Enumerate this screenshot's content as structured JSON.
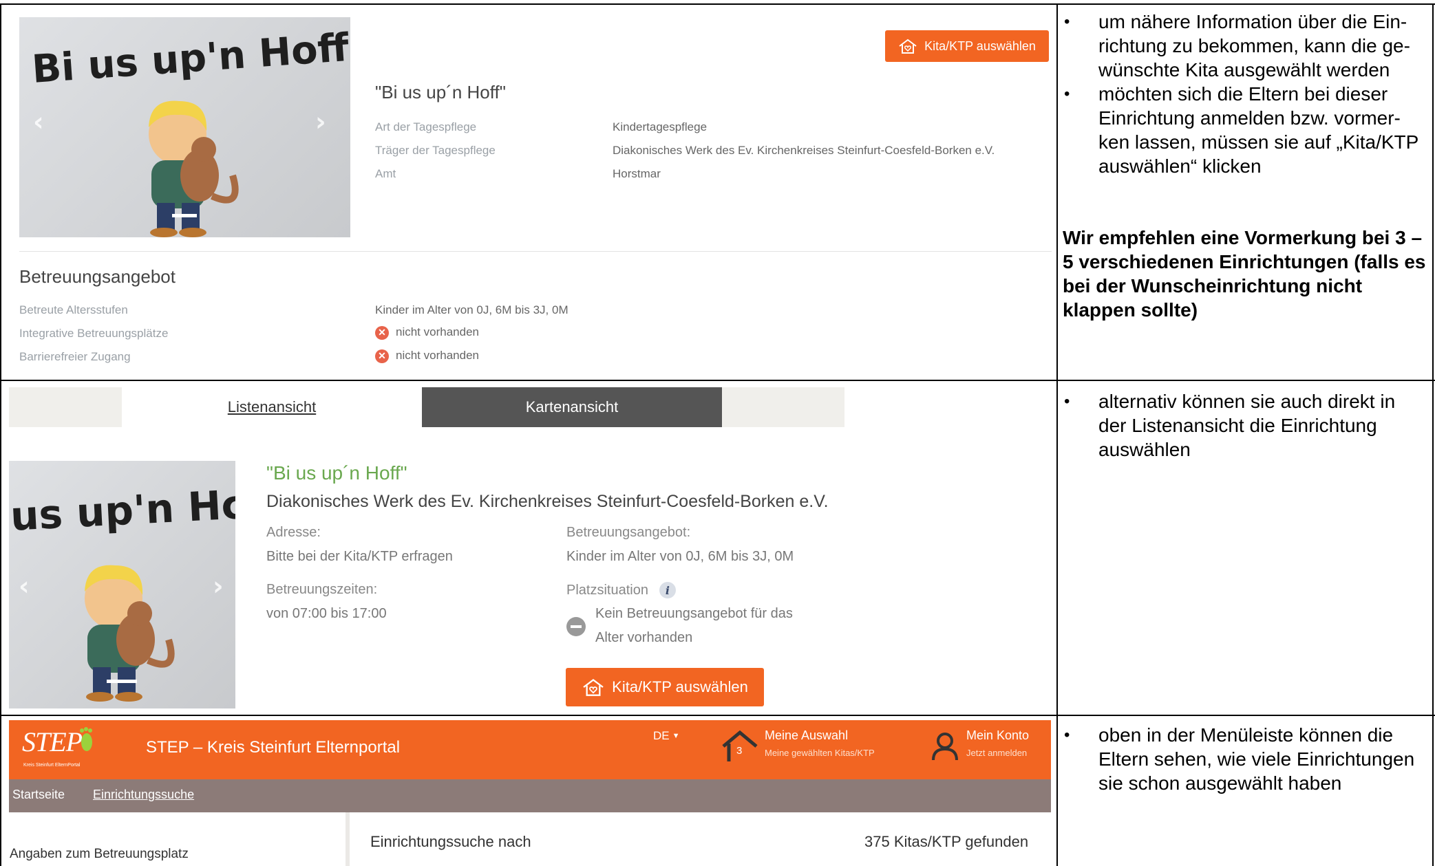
{
  "section1": {
    "photo_text": "Bi us up'n Hoff",
    "select_button": "Kita/KTP auswählen",
    "name": "\"Bi us up´n Hoff\"",
    "details": [
      {
        "label": "Art der Tagespflege",
        "value": "Kindertagespflege"
      },
      {
        "label": "Träger der Tagespflege",
        "value": "Diakonisches Werk des Ev. Kirchenkreises Steinfurt-Coesfeld-Borken e.V."
      },
      {
        "label": "Amt",
        "value": "Horstmar"
      }
    ],
    "offer_heading": "Betreuungsangebot",
    "offer": [
      {
        "label": "Betreute Altersstufen",
        "value": "Kinder im Alter von 0J, 6M bis 3J, 0M"
      },
      {
        "label": "Integrative Betreuungsplätze",
        "value": "nicht vorhanden"
      },
      {
        "label": "Barrierefreier Zugang",
        "value": "nicht vorhanden"
      }
    ],
    "notes": [
      "um nähere Information über die Ein-richtung zu bekommen, kann die ge-wünschte Kita ausgewählt werden",
      "möchten sich die Eltern bei dieser Einrichtung anmelden bzw. vormer-ken lassen, müssen sie auf „Kita/KTP auswählen“ klicken"
    ],
    "bold_note": "Wir empfehlen eine Vormerkung bei 3 – 5 verschiedenen Einrichtungen (falls es bei der Wunscheinrichtung nicht klappen sollte)"
  },
  "section2": {
    "tab_list": "Listenansicht",
    "tab_map": "Kartenansicht",
    "photo_text": "us up'n Hc",
    "name": "\"Bi us up´n Hoff\"",
    "carrier": "Diakonisches Werk des Ev. Kirchenkreises Steinfurt-Coesfeld-Borken e.V.",
    "address_label": "Adresse:",
    "address_value": "Bitte bei der Kita/KTP erfragen",
    "hours_label": "Betreuungszeiten:",
    "hours_value": "von 07:00 bis 17:00",
    "offer_label": "Betreuungsangebot:",
    "offer_value": "Kinder im Alter von 0J, 6M bis 3J, 0M",
    "place_label": "Platzsituation",
    "place_value_1": "Kein Betreuungsangebot für das",
    "place_value_2": "Alter vorhanden",
    "select_button": "Kita/KTP auswählen",
    "notes": [
      "alternativ können sie auch direkt in der Listenansicht die Einrichtung auswählen"
    ]
  },
  "section3": {
    "logo": "STEP",
    "logo_sub": "Kreis Steinfurt ElternPortal",
    "portal_title": "STEP – Kreis Steinfurt Elternportal",
    "lang": "DE",
    "selection_count": "3",
    "selection_title": "Meine Auswahl",
    "selection_sub": "Meine gewählten Kitas/KTP",
    "account_title": "Mein Konto",
    "account_sub": "Jetzt anmelden",
    "nav": [
      "Startseite",
      "Einrichtungssuche"
    ],
    "sidebar_label": "Angaben zum Betreuungsplatz",
    "search_label": "Einrichtungssuche nach",
    "results": "375 Kitas/KTP gefunden",
    "notes": [
      "oben in der Menüleiste können die Eltern sehen, wie viele Einrichtungen sie schon ausgewählt haben"
    ]
  },
  "colors": {
    "accent": "#f26522",
    "nav_bar": "#8c7b78",
    "tab_active": "#555555",
    "green_name": "#6aa84f"
  }
}
